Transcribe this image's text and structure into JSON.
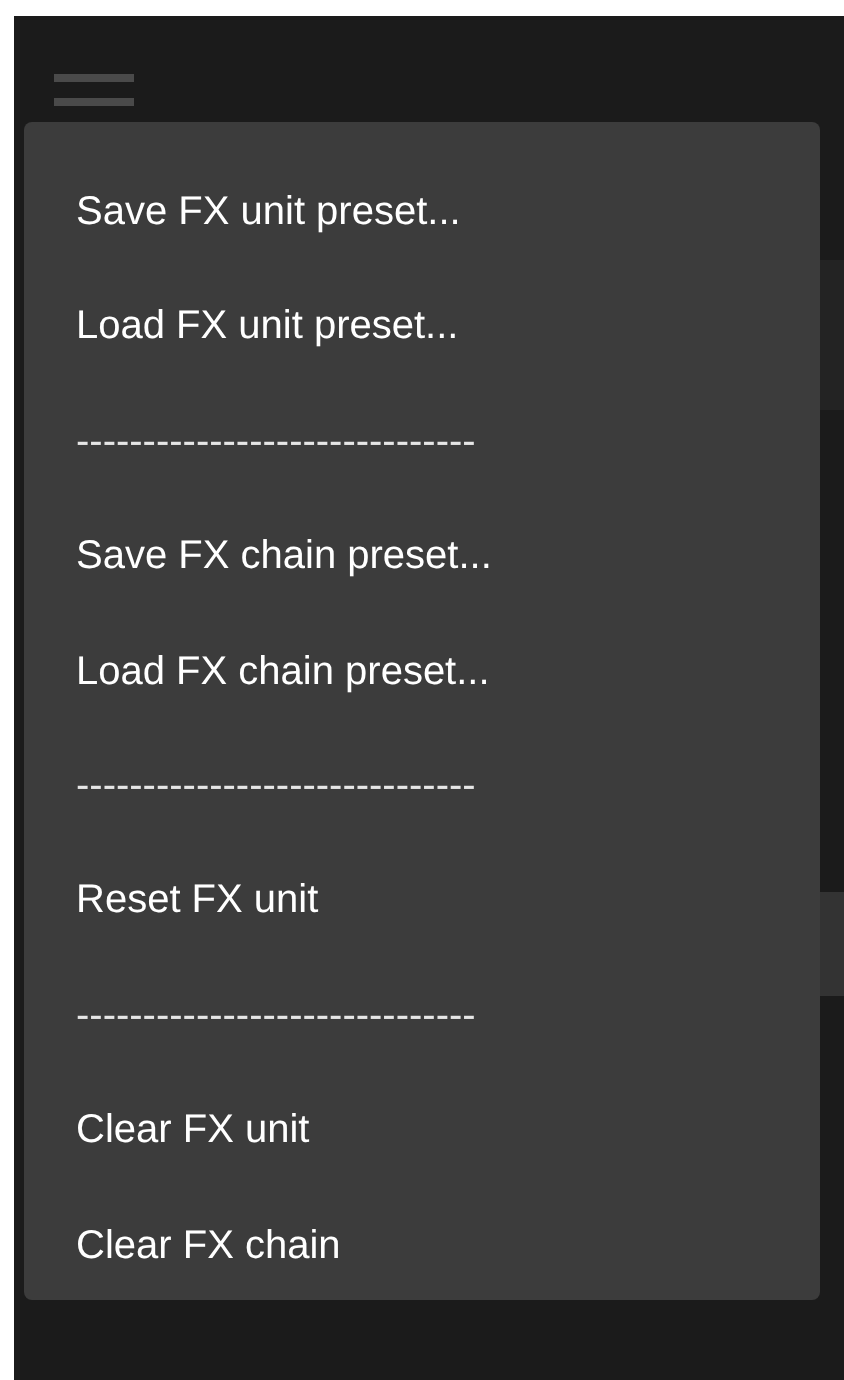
{
  "menu_button": {
    "kind": "hamburger"
  },
  "menu": {
    "items": [
      {
        "kind": "item",
        "label": "Save FX unit preset..."
      },
      {
        "kind": "item",
        "label": "Load FX unit preset..."
      },
      {
        "kind": "separator",
        "label": "------------------------------"
      },
      {
        "kind": "item",
        "label": "Save FX chain preset..."
      },
      {
        "kind": "item",
        "label": "Load FX chain preset..."
      },
      {
        "kind": "separator",
        "label": "------------------------------"
      },
      {
        "kind": "item",
        "label": "Reset FX unit"
      },
      {
        "kind": "separator",
        "label": "------------------------------"
      },
      {
        "kind": "item",
        "label": "Clear FX unit"
      },
      {
        "kind": "item",
        "label": "Clear FX chain"
      }
    ]
  }
}
